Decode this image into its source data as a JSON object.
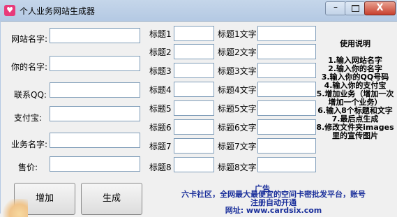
{
  "window": {
    "title": "个人业务网站生成器",
    "minimize": "–",
    "close": "X",
    "app_icon": "app-icon"
  },
  "left": {
    "site_name_label": "网站名字:",
    "your_name_label": "你的名字:",
    "qq_label": "联系QQ:",
    "alipay_label": "支付宝:",
    "business_name_label": "业务名字:",
    "price_label": "售价:"
  },
  "titles": [
    {
      "label": "标题1",
      "text_label": "标题1文字"
    },
    {
      "label": "标题2",
      "text_label": "标题2文字"
    },
    {
      "label": "标题3",
      "text_label": "标题3文字"
    },
    {
      "label": "标题4",
      "text_label": "标题4文字"
    },
    {
      "label": "标题5",
      "text_label": "标题5文字"
    },
    {
      "label": "标题6",
      "text_label": "标题6文字"
    },
    {
      "label": "标题7",
      "text_label": "标题7文字"
    },
    {
      "label": "标题8",
      "text_label": "标题8文字"
    }
  ],
  "buttons": {
    "add": "增加",
    "generate": "生成"
  },
  "help": {
    "title": "使用说明",
    "body": "1.输入网站名字\n2.输入你的名字\n3.输入你的QQ号码\n4.输入你的支付宝\n5.增加业务（增加一次增加一个业务）\n6.输入8个标题和文字\n7.最后点生成\n8.修改文件夹images里的宣传图片"
  },
  "ad": {
    "title": "广告",
    "line1": "六卡社区，全网最大最便宜的空间卡密批发平台，账号",
    "line2": "注册自动开通",
    "line3": "网址: www.cardsix.com"
  }
}
